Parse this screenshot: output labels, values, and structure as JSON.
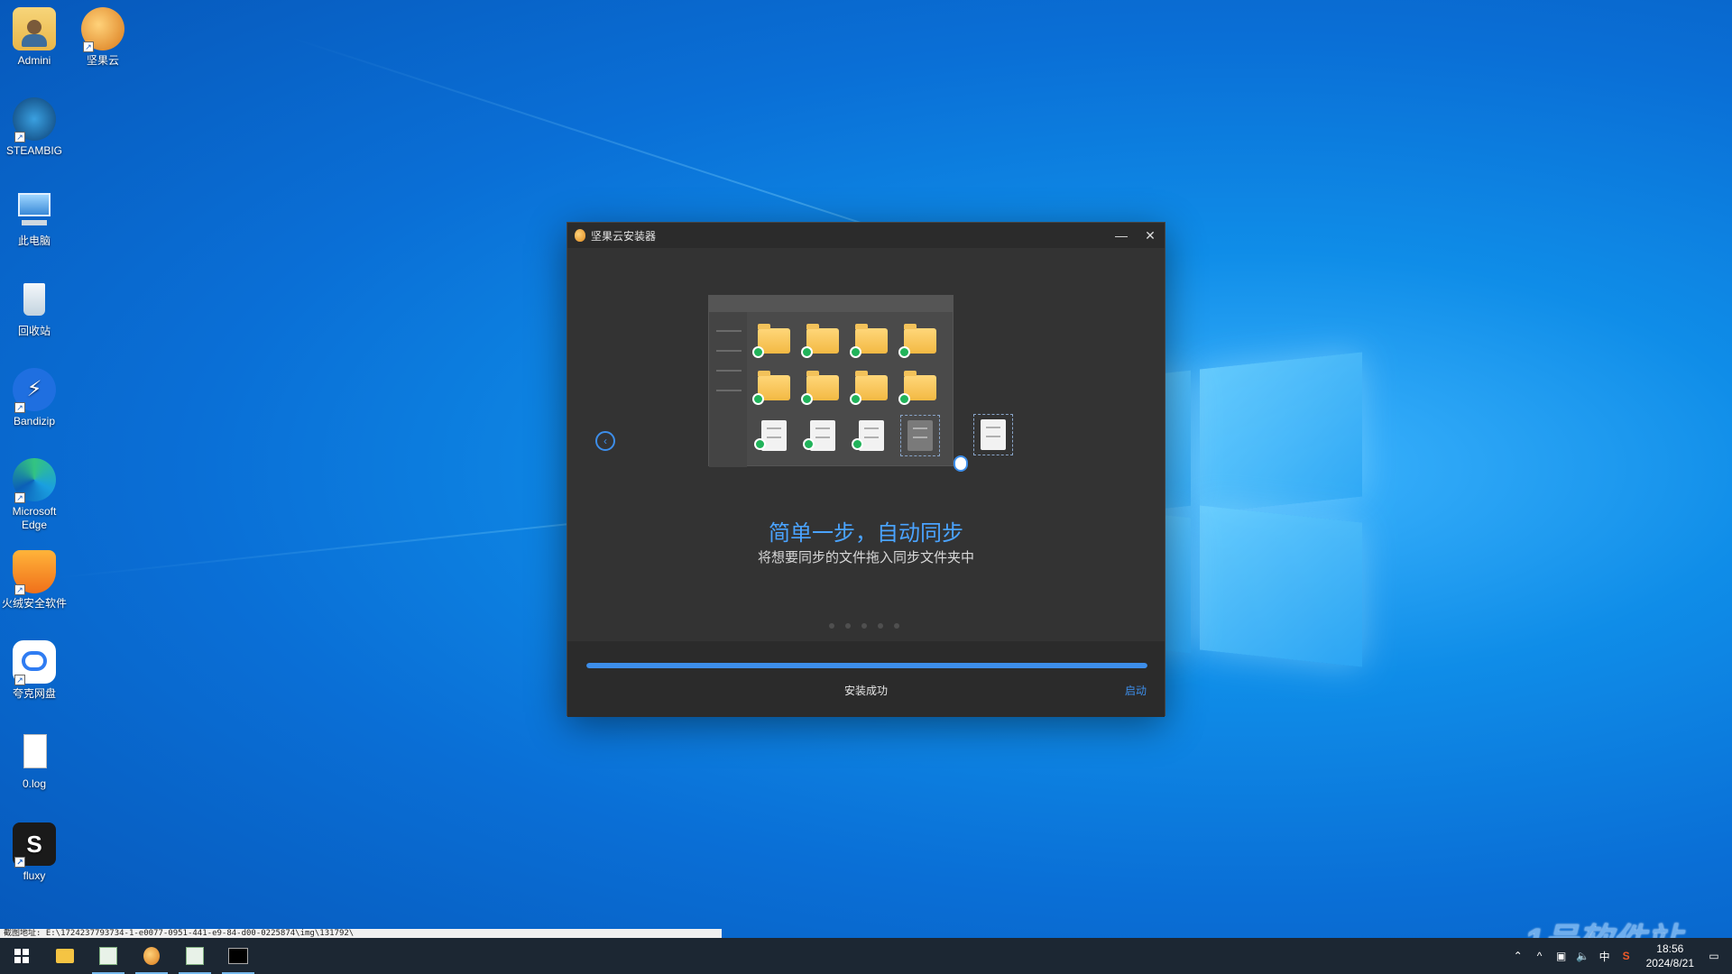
{
  "desktop": {
    "icons": [
      {
        "label": "Admini"
      },
      {
        "label": "坚果云"
      },
      {
        "label": "STEAMBIG"
      },
      {
        "label": "此电脑"
      },
      {
        "label": "回收站"
      },
      {
        "label": "Bandizip"
      },
      {
        "label": "Microsoft Edge"
      },
      {
        "label": "火绒安全软件"
      },
      {
        "label": "夸克网盘"
      },
      {
        "label": "0.log"
      },
      {
        "label": "fluxy"
      }
    ]
  },
  "dialog": {
    "title": "坚果云安装器",
    "minimize_glyph": "—",
    "close_glyph": "✕",
    "headline": "简单一步，自动同步",
    "subline": "将想要同步的文件拖入同步文件夹中",
    "progress": 1.0,
    "status": "安装成功",
    "launch_label": "启动"
  },
  "taskbar": {
    "tooltip": "截图地址: E:\\1724237793734-1-e0077-0951-441-e9-84-d00-0225874\\img\\131792\\",
    "clock_time": "18:56",
    "clock_date": "2024/8/21",
    "ime": "中"
  },
  "watermark": "1号软件站",
  "colors": {
    "accent": "#3d8eea",
    "headline": "#4aa3ff",
    "desktop": "#0a6fd6"
  }
}
